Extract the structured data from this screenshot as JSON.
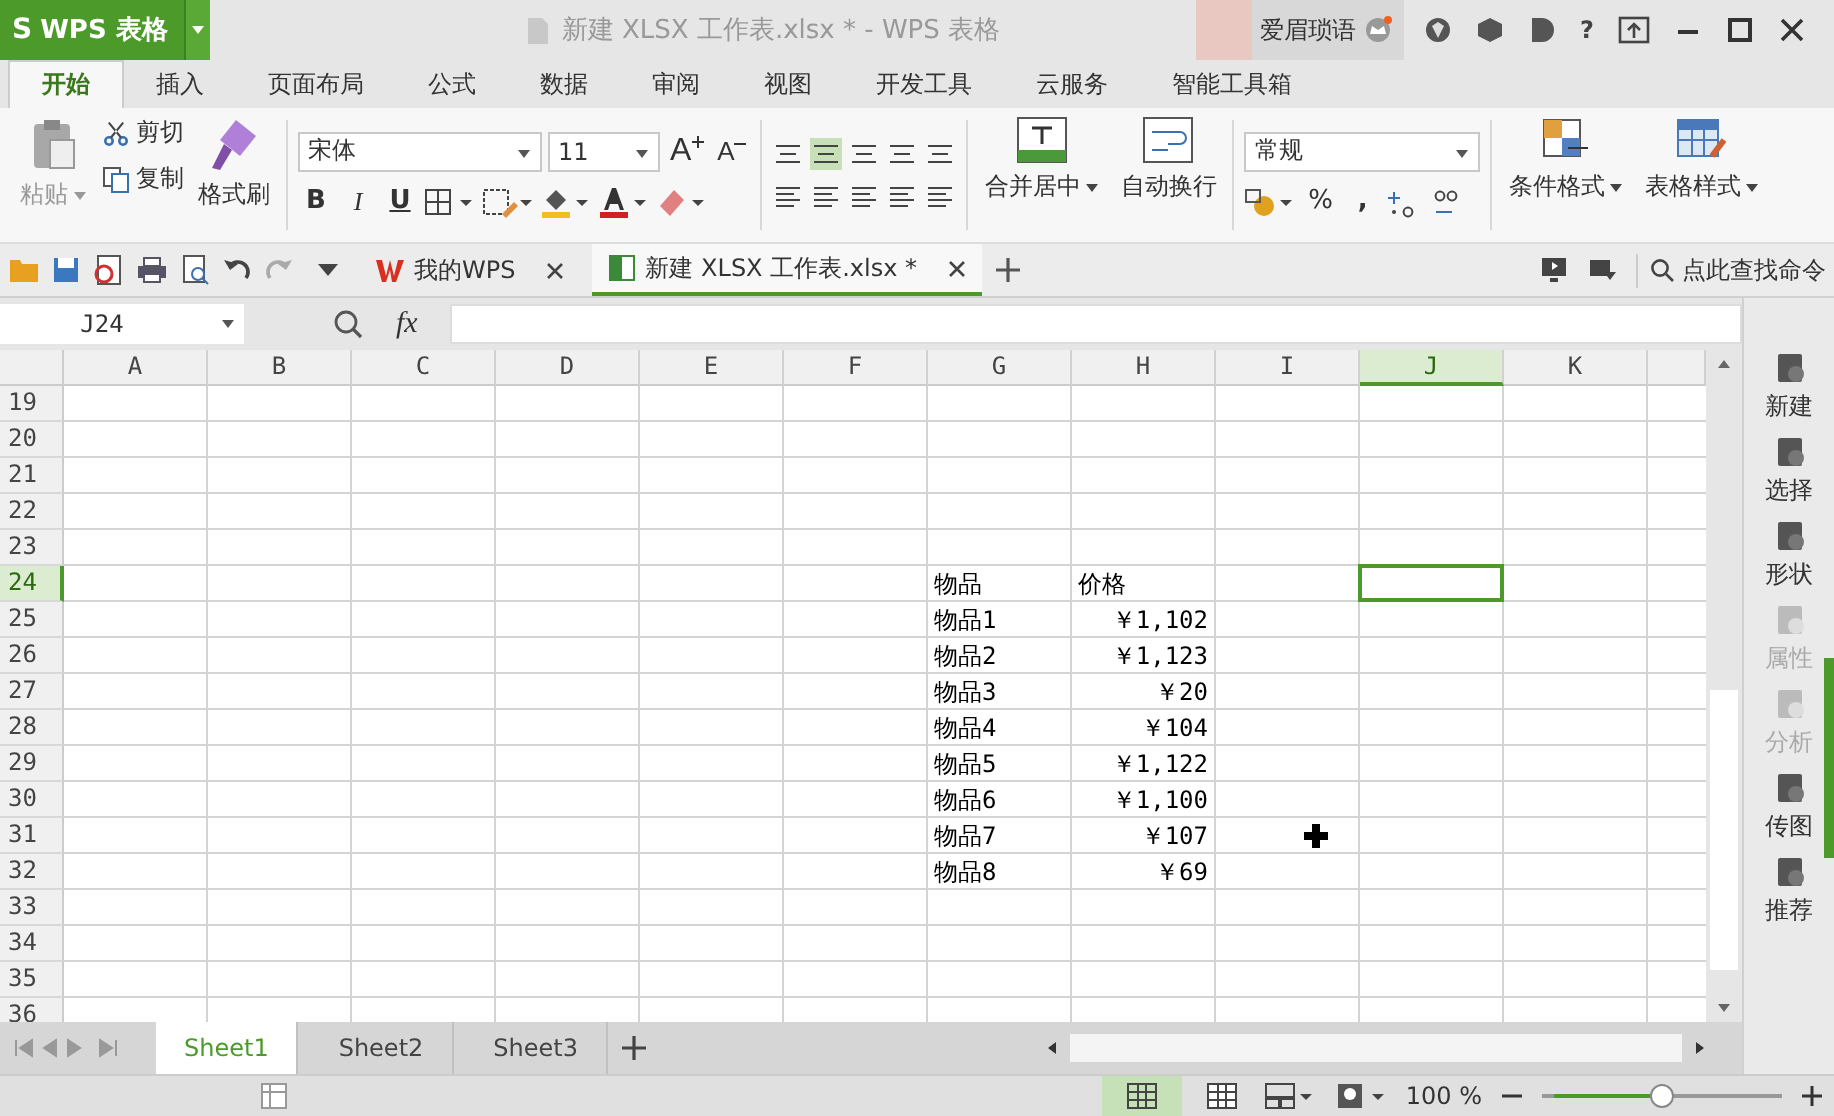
{
  "title_bar": {
    "logo_letter": "S",
    "app_name": "WPS 表格",
    "title": "新建 XLSX 工作表.xlsx * - WPS 表格",
    "user": "爱眉琐语",
    "help": "?"
  },
  "ribbon_tabs": [
    {
      "label": "开始",
      "selected": true
    },
    {
      "label": "插入",
      "selected": false
    },
    {
      "label": "页面布局",
      "selected": false
    },
    {
      "label": "公式",
      "selected": false
    },
    {
      "label": "数据",
      "selected": false
    },
    {
      "label": "审阅",
      "selected": false
    },
    {
      "label": "视图",
      "selected": false
    },
    {
      "label": "开发工具",
      "selected": false
    },
    {
      "label": "云服务",
      "selected": false
    },
    {
      "label": "智能工具箱",
      "selected": false
    }
  ],
  "ribbon": {
    "paste": "粘贴",
    "cut": "剪切",
    "copy": "复制",
    "format_painter": "格式刷",
    "font": "宋体",
    "font_size": "11",
    "grow_font": "A",
    "shrink_font": "A",
    "bold": "B",
    "italic": "I",
    "underline": "U",
    "merge_center": "合并居中",
    "wrap_text": "自动换行",
    "number_format": "常规",
    "percent": "%",
    "comma": ",",
    "conditional_format": "条件格式",
    "table_style": "表格样式"
  },
  "doc_tabs": [
    {
      "label": "我的WPS",
      "selected": false
    },
    {
      "label": "新建 XLSX 工作表.xlsx *",
      "selected": true
    }
  ],
  "command_search": {
    "placeholder": "点此查找命令"
  },
  "formula_bar": {
    "name_box": "J24",
    "fx": "fx"
  },
  "columns": [
    {
      "label": "A",
      "selected": false
    },
    {
      "label": "B",
      "selected": false
    },
    {
      "label": "C",
      "selected": false
    },
    {
      "label": "D",
      "selected": false
    },
    {
      "label": "E",
      "selected": false
    },
    {
      "label": "F",
      "selected": false
    },
    {
      "label": "G",
      "selected": false
    },
    {
      "label": "H",
      "selected": false
    },
    {
      "label": "I",
      "selected": false
    },
    {
      "label": "J",
      "selected": true
    },
    {
      "label": "K",
      "selected": false
    }
  ],
  "rows": [
    {
      "number": "19",
      "selected": false
    },
    {
      "number": "20",
      "selected": false
    },
    {
      "number": "21",
      "selected": false
    },
    {
      "number": "22",
      "selected": false
    },
    {
      "number": "23",
      "selected": false
    },
    {
      "number": "24",
      "selected": true,
      "kind": "header",
      "item": "物品",
      "price": "价格"
    },
    {
      "number": "25",
      "selected": false,
      "item": "物品1",
      "price": "￥1,102"
    },
    {
      "number": "26",
      "selected": false,
      "item": "物品2",
      "price": "￥1,123"
    },
    {
      "number": "27",
      "selected": false,
      "item": "物品3",
      "price": "￥20"
    },
    {
      "number": "28",
      "selected": false,
      "item": "物品4",
      "price": "￥104"
    },
    {
      "number": "29",
      "selected": false,
      "item": "物品5",
      "price": "￥1,122"
    },
    {
      "number": "30",
      "selected": false,
      "item": "物品6",
      "price": "￥1,100"
    },
    {
      "number": "31",
      "selected": false,
      "item": "物品7",
      "price": "￥107"
    },
    {
      "number": "32",
      "selected": false,
      "item": "物品8",
      "price": "￥69"
    },
    {
      "number": "33",
      "selected": false
    },
    {
      "number": "34",
      "selected": false
    },
    {
      "number": "35",
      "selected": false
    },
    {
      "number": "36",
      "selected": false
    }
  ],
  "side_panel": [
    {
      "label": "新建",
      "disabled": false
    },
    {
      "label": "选择",
      "disabled": false
    },
    {
      "label": "形状",
      "disabled": false
    },
    {
      "label": "属性",
      "disabled": true
    },
    {
      "label": "分析",
      "disabled": true
    },
    {
      "label": "传图",
      "disabled": false
    },
    {
      "label": "推荐",
      "disabled": false
    }
  ],
  "sheet_tabs": [
    {
      "label": "Sheet1",
      "selected": true
    },
    {
      "label": "Sheet2",
      "selected": false
    },
    {
      "label": "Sheet3",
      "selected": false
    }
  ],
  "status_bar": {
    "zoom": "100 %",
    "zoom_slider": {
      "level": 0.5
    }
  }
}
